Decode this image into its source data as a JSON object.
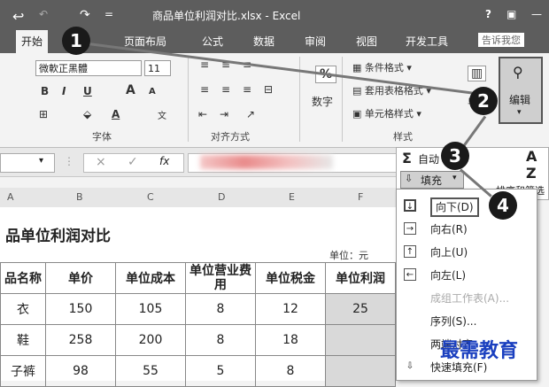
{
  "title_bar": {
    "title": "商品单位利润对比.xlsx - Excel",
    "help": "?",
    "restore": "▣",
    "minimize": "—",
    "undo_glyph": "↶",
    "redo_glyph": "↷",
    "save_glyph": "↩",
    "qat_more": "="
  },
  "tabs": [
    "开始",
    "页面布局",
    "公式",
    "数据",
    "审阅",
    "视图",
    "开发工具"
  ],
  "tell_me": "告诉我您",
  "ribbon": {
    "font_name": "微軟正黑體",
    "font_size": "11",
    "bold": "B",
    "italic": "I",
    "underline": "U",
    "grow_font": "A",
    "shrink_font": "A",
    "font_color": "A",
    "wen": "文",
    "font_group": "字体",
    "align_group": "对齐方式",
    "percent": "%",
    "number": "数字",
    "cond_format": "条件格式",
    "table_format": "套用表格格式",
    "cell_styles": "单元格样式",
    "styles_group": "样式",
    "cells_abbrev": "单",
    "edit": "编辑"
  },
  "formula_bar": {
    "cancel": "×",
    "enter": "✓",
    "fx": "fx"
  },
  "autosum": {
    "sigma": "Σ",
    "label": "自动",
    "fill_label": "填充",
    "sort_label": "排序和筛选",
    "az": "A Z"
  },
  "fill_menu": {
    "items": [
      {
        "label": "向下(D)",
        "icon": "↓"
      },
      {
        "label": "向右(R)",
        "icon": "→"
      },
      {
        "label": "向上(U)",
        "icon": "↑"
      },
      {
        "label": "向左(L)",
        "icon": "←"
      },
      {
        "label": "成组工作表(A)...",
        "icon": ""
      },
      {
        "label": "序列(S)...",
        "icon": ""
      },
      {
        "label": "两端对齐",
        "icon": ""
      },
      {
        "label": "快速填充(F)",
        "icon": "⇩"
      }
    ]
  },
  "column_headers": [
    "A",
    "B",
    "C",
    "D",
    "E",
    "F"
  ],
  "sheet": {
    "title": "品单位利润对比",
    "unit": "单位：元",
    "headers": [
      "品名称",
      "单价",
      "单位成本",
      "单位营业费用",
      "单位税金",
      "单位利润"
    ],
    "rows": [
      [
        "衣",
        "150",
        "105",
        "8",
        "12",
        "25"
      ],
      [
        "鞋",
        "258",
        "200",
        "8",
        "18",
        ""
      ],
      [
        "子裤",
        "98",
        "55",
        "5",
        "8",
        ""
      ]
    ]
  },
  "markers": [
    "1",
    "2",
    "3",
    "4"
  ],
  "watermark": "最需教育",
  "colors": {
    "titlebar": "#5d5d5d",
    "highlight": "#d9d9d9",
    "marker": "#1a1a1a",
    "watermark": "#1a3fbf"
  }
}
